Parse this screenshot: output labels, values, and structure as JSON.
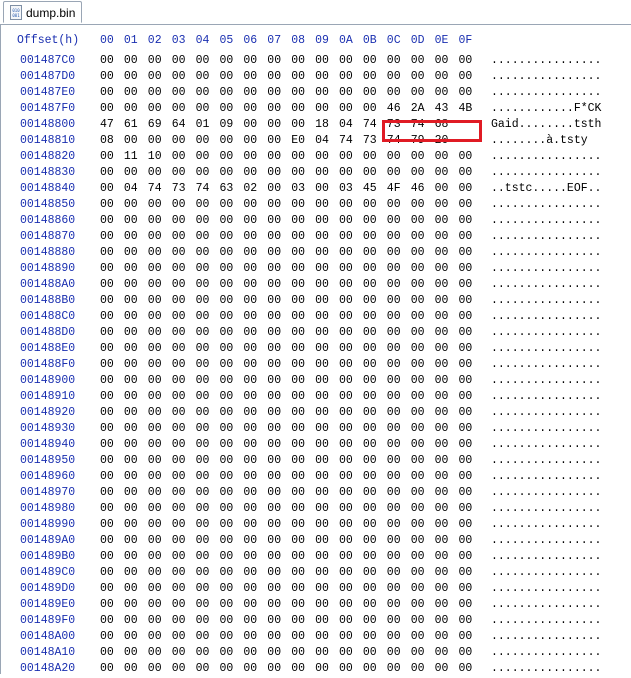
{
  "tab": {
    "filename": "dump.bin",
    "icon": "binary-file-icon",
    "icon_text": "010 001"
  },
  "header": {
    "offset_label": "Offset(h)",
    "columns": [
      "00",
      "01",
      "02",
      "03",
      "04",
      "05",
      "06",
      "07",
      "08",
      "09",
      "0A",
      "0B",
      "0C",
      "0D",
      "0E",
      "0F"
    ]
  },
  "colors": {
    "offset": "#1a2fb0",
    "highlight": "#e01b24"
  },
  "highlight": {
    "offset": "001487F0",
    "bytes": [
      "46",
      "2A",
      "43",
      "4B"
    ]
  },
  "rows": [
    {
      "offset": "001487C0",
      "bytes": [
        "00",
        "00",
        "00",
        "00",
        "00",
        "00",
        "00",
        "00",
        "00",
        "00",
        "00",
        "00",
        "00",
        "00",
        "00",
        "00"
      ],
      "ascii": "................"
    },
    {
      "offset": "001487D0",
      "bytes": [
        "00",
        "00",
        "00",
        "00",
        "00",
        "00",
        "00",
        "00",
        "00",
        "00",
        "00",
        "00",
        "00",
        "00",
        "00",
        "00"
      ],
      "ascii": "................"
    },
    {
      "offset": "001487E0",
      "bytes": [
        "00",
        "00",
        "00",
        "00",
        "00",
        "00",
        "00",
        "00",
        "00",
        "00",
        "00",
        "00",
        "00",
        "00",
        "00",
        "00"
      ],
      "ascii": "................"
    },
    {
      "offset": "001487F0",
      "bytes": [
        "00",
        "00",
        "00",
        "00",
        "00",
        "00",
        "00",
        "00",
        "00",
        "00",
        "00",
        "00",
        "46",
        "2A",
        "43",
        "4B"
      ],
      "ascii": "............F*CK"
    },
    {
      "offset": "00148800",
      "bytes": [
        "47",
        "61",
        "69",
        "64",
        "01",
        "09",
        "00",
        "00",
        "00",
        "18",
        "04",
        "74",
        "73",
        "74",
        "68"
      ],
      "ascii": "Gaid........tsth"
    },
    {
      "offset": "00148810",
      "bytes": [
        "08",
        "00",
        "00",
        "00",
        "00",
        "00",
        "00",
        "00",
        "E0",
        "04",
        "74",
        "73",
        "74",
        "79",
        "20"
      ],
      "ascii": "........à.tsty "
    },
    {
      "offset": "00148820",
      "bytes": [
        "00",
        "11",
        "10",
        "00",
        "00",
        "00",
        "00",
        "00",
        "00",
        "00",
        "00",
        "00",
        "00",
        "00",
        "00",
        "00"
      ],
      "ascii": "................"
    },
    {
      "offset": "00148830",
      "bytes": [
        "00",
        "00",
        "00",
        "00",
        "00",
        "00",
        "00",
        "00",
        "00",
        "00",
        "00",
        "00",
        "00",
        "00",
        "00",
        "00"
      ],
      "ascii": "................"
    },
    {
      "offset": "00148840",
      "bytes": [
        "00",
        "04",
        "74",
        "73",
        "74",
        "63",
        "02",
        "00",
        "03",
        "00",
        "03",
        "45",
        "4F",
        "46",
        "00",
        "00"
      ],
      "ascii": "..tstc.....EOF.."
    },
    {
      "offset": "00148850",
      "bytes": [
        "00",
        "00",
        "00",
        "00",
        "00",
        "00",
        "00",
        "00",
        "00",
        "00",
        "00",
        "00",
        "00",
        "00",
        "00",
        "00"
      ],
      "ascii": "................"
    },
    {
      "offset": "00148860",
      "bytes": [
        "00",
        "00",
        "00",
        "00",
        "00",
        "00",
        "00",
        "00",
        "00",
        "00",
        "00",
        "00",
        "00",
        "00",
        "00",
        "00"
      ],
      "ascii": "................"
    },
    {
      "offset": "00148870",
      "bytes": [
        "00",
        "00",
        "00",
        "00",
        "00",
        "00",
        "00",
        "00",
        "00",
        "00",
        "00",
        "00",
        "00",
        "00",
        "00",
        "00"
      ],
      "ascii": "................"
    },
    {
      "offset": "00148880",
      "bytes": [
        "00",
        "00",
        "00",
        "00",
        "00",
        "00",
        "00",
        "00",
        "00",
        "00",
        "00",
        "00",
        "00",
        "00",
        "00",
        "00"
      ],
      "ascii": "................"
    },
    {
      "offset": "00148890",
      "bytes": [
        "00",
        "00",
        "00",
        "00",
        "00",
        "00",
        "00",
        "00",
        "00",
        "00",
        "00",
        "00",
        "00",
        "00",
        "00",
        "00"
      ],
      "ascii": "................"
    },
    {
      "offset": "001488A0",
      "bytes": [
        "00",
        "00",
        "00",
        "00",
        "00",
        "00",
        "00",
        "00",
        "00",
        "00",
        "00",
        "00",
        "00",
        "00",
        "00",
        "00"
      ],
      "ascii": "................"
    },
    {
      "offset": "001488B0",
      "bytes": [
        "00",
        "00",
        "00",
        "00",
        "00",
        "00",
        "00",
        "00",
        "00",
        "00",
        "00",
        "00",
        "00",
        "00",
        "00",
        "00"
      ],
      "ascii": "................"
    },
    {
      "offset": "001488C0",
      "bytes": [
        "00",
        "00",
        "00",
        "00",
        "00",
        "00",
        "00",
        "00",
        "00",
        "00",
        "00",
        "00",
        "00",
        "00",
        "00",
        "00"
      ],
      "ascii": "................"
    },
    {
      "offset": "001488D0",
      "bytes": [
        "00",
        "00",
        "00",
        "00",
        "00",
        "00",
        "00",
        "00",
        "00",
        "00",
        "00",
        "00",
        "00",
        "00",
        "00",
        "00"
      ],
      "ascii": "................"
    },
    {
      "offset": "001488E0",
      "bytes": [
        "00",
        "00",
        "00",
        "00",
        "00",
        "00",
        "00",
        "00",
        "00",
        "00",
        "00",
        "00",
        "00",
        "00",
        "00",
        "00"
      ],
      "ascii": "................"
    },
    {
      "offset": "001488F0",
      "bytes": [
        "00",
        "00",
        "00",
        "00",
        "00",
        "00",
        "00",
        "00",
        "00",
        "00",
        "00",
        "00",
        "00",
        "00",
        "00",
        "00"
      ],
      "ascii": "................"
    },
    {
      "offset": "00148900",
      "bytes": [
        "00",
        "00",
        "00",
        "00",
        "00",
        "00",
        "00",
        "00",
        "00",
        "00",
        "00",
        "00",
        "00",
        "00",
        "00",
        "00"
      ],
      "ascii": "................"
    },
    {
      "offset": "00148910",
      "bytes": [
        "00",
        "00",
        "00",
        "00",
        "00",
        "00",
        "00",
        "00",
        "00",
        "00",
        "00",
        "00",
        "00",
        "00",
        "00",
        "00"
      ],
      "ascii": "................"
    },
    {
      "offset": "00148920",
      "bytes": [
        "00",
        "00",
        "00",
        "00",
        "00",
        "00",
        "00",
        "00",
        "00",
        "00",
        "00",
        "00",
        "00",
        "00",
        "00",
        "00"
      ],
      "ascii": "................"
    },
    {
      "offset": "00148930",
      "bytes": [
        "00",
        "00",
        "00",
        "00",
        "00",
        "00",
        "00",
        "00",
        "00",
        "00",
        "00",
        "00",
        "00",
        "00",
        "00",
        "00"
      ],
      "ascii": "................"
    },
    {
      "offset": "00148940",
      "bytes": [
        "00",
        "00",
        "00",
        "00",
        "00",
        "00",
        "00",
        "00",
        "00",
        "00",
        "00",
        "00",
        "00",
        "00",
        "00",
        "00"
      ],
      "ascii": "................"
    },
    {
      "offset": "00148950",
      "bytes": [
        "00",
        "00",
        "00",
        "00",
        "00",
        "00",
        "00",
        "00",
        "00",
        "00",
        "00",
        "00",
        "00",
        "00",
        "00",
        "00"
      ],
      "ascii": "................"
    },
    {
      "offset": "00148960",
      "bytes": [
        "00",
        "00",
        "00",
        "00",
        "00",
        "00",
        "00",
        "00",
        "00",
        "00",
        "00",
        "00",
        "00",
        "00",
        "00",
        "00"
      ],
      "ascii": "................"
    },
    {
      "offset": "00148970",
      "bytes": [
        "00",
        "00",
        "00",
        "00",
        "00",
        "00",
        "00",
        "00",
        "00",
        "00",
        "00",
        "00",
        "00",
        "00",
        "00",
        "00"
      ],
      "ascii": "................"
    },
    {
      "offset": "00148980",
      "bytes": [
        "00",
        "00",
        "00",
        "00",
        "00",
        "00",
        "00",
        "00",
        "00",
        "00",
        "00",
        "00",
        "00",
        "00",
        "00",
        "00"
      ],
      "ascii": "................"
    },
    {
      "offset": "00148990",
      "bytes": [
        "00",
        "00",
        "00",
        "00",
        "00",
        "00",
        "00",
        "00",
        "00",
        "00",
        "00",
        "00",
        "00",
        "00",
        "00",
        "00"
      ],
      "ascii": "................"
    },
    {
      "offset": "001489A0",
      "bytes": [
        "00",
        "00",
        "00",
        "00",
        "00",
        "00",
        "00",
        "00",
        "00",
        "00",
        "00",
        "00",
        "00",
        "00",
        "00",
        "00"
      ],
      "ascii": "................"
    },
    {
      "offset": "001489B0",
      "bytes": [
        "00",
        "00",
        "00",
        "00",
        "00",
        "00",
        "00",
        "00",
        "00",
        "00",
        "00",
        "00",
        "00",
        "00",
        "00",
        "00"
      ],
      "ascii": "................"
    },
    {
      "offset": "001489C0",
      "bytes": [
        "00",
        "00",
        "00",
        "00",
        "00",
        "00",
        "00",
        "00",
        "00",
        "00",
        "00",
        "00",
        "00",
        "00",
        "00",
        "00"
      ],
      "ascii": "................"
    },
    {
      "offset": "001489D0",
      "bytes": [
        "00",
        "00",
        "00",
        "00",
        "00",
        "00",
        "00",
        "00",
        "00",
        "00",
        "00",
        "00",
        "00",
        "00",
        "00",
        "00"
      ],
      "ascii": "................"
    },
    {
      "offset": "001489E0",
      "bytes": [
        "00",
        "00",
        "00",
        "00",
        "00",
        "00",
        "00",
        "00",
        "00",
        "00",
        "00",
        "00",
        "00",
        "00",
        "00",
        "00"
      ],
      "ascii": "................"
    },
    {
      "offset": "001489F0",
      "bytes": [
        "00",
        "00",
        "00",
        "00",
        "00",
        "00",
        "00",
        "00",
        "00",
        "00",
        "00",
        "00",
        "00",
        "00",
        "00",
        "00"
      ],
      "ascii": "................"
    },
    {
      "offset": "00148A00",
      "bytes": [
        "00",
        "00",
        "00",
        "00",
        "00",
        "00",
        "00",
        "00",
        "00",
        "00",
        "00",
        "00",
        "00",
        "00",
        "00",
        "00"
      ],
      "ascii": "................"
    },
    {
      "offset": "00148A10",
      "bytes": [
        "00",
        "00",
        "00",
        "00",
        "00",
        "00",
        "00",
        "00",
        "00",
        "00",
        "00",
        "00",
        "00",
        "00",
        "00",
        "00"
      ],
      "ascii": "................"
    },
    {
      "offset": "00148A20",
      "bytes": [
        "00",
        "00",
        "00",
        "00",
        "00",
        "00",
        "00",
        "00",
        "00",
        "00",
        "00",
        "00",
        "00",
        "00",
        "00",
        "00"
      ],
      "ascii": "................"
    }
  ]
}
